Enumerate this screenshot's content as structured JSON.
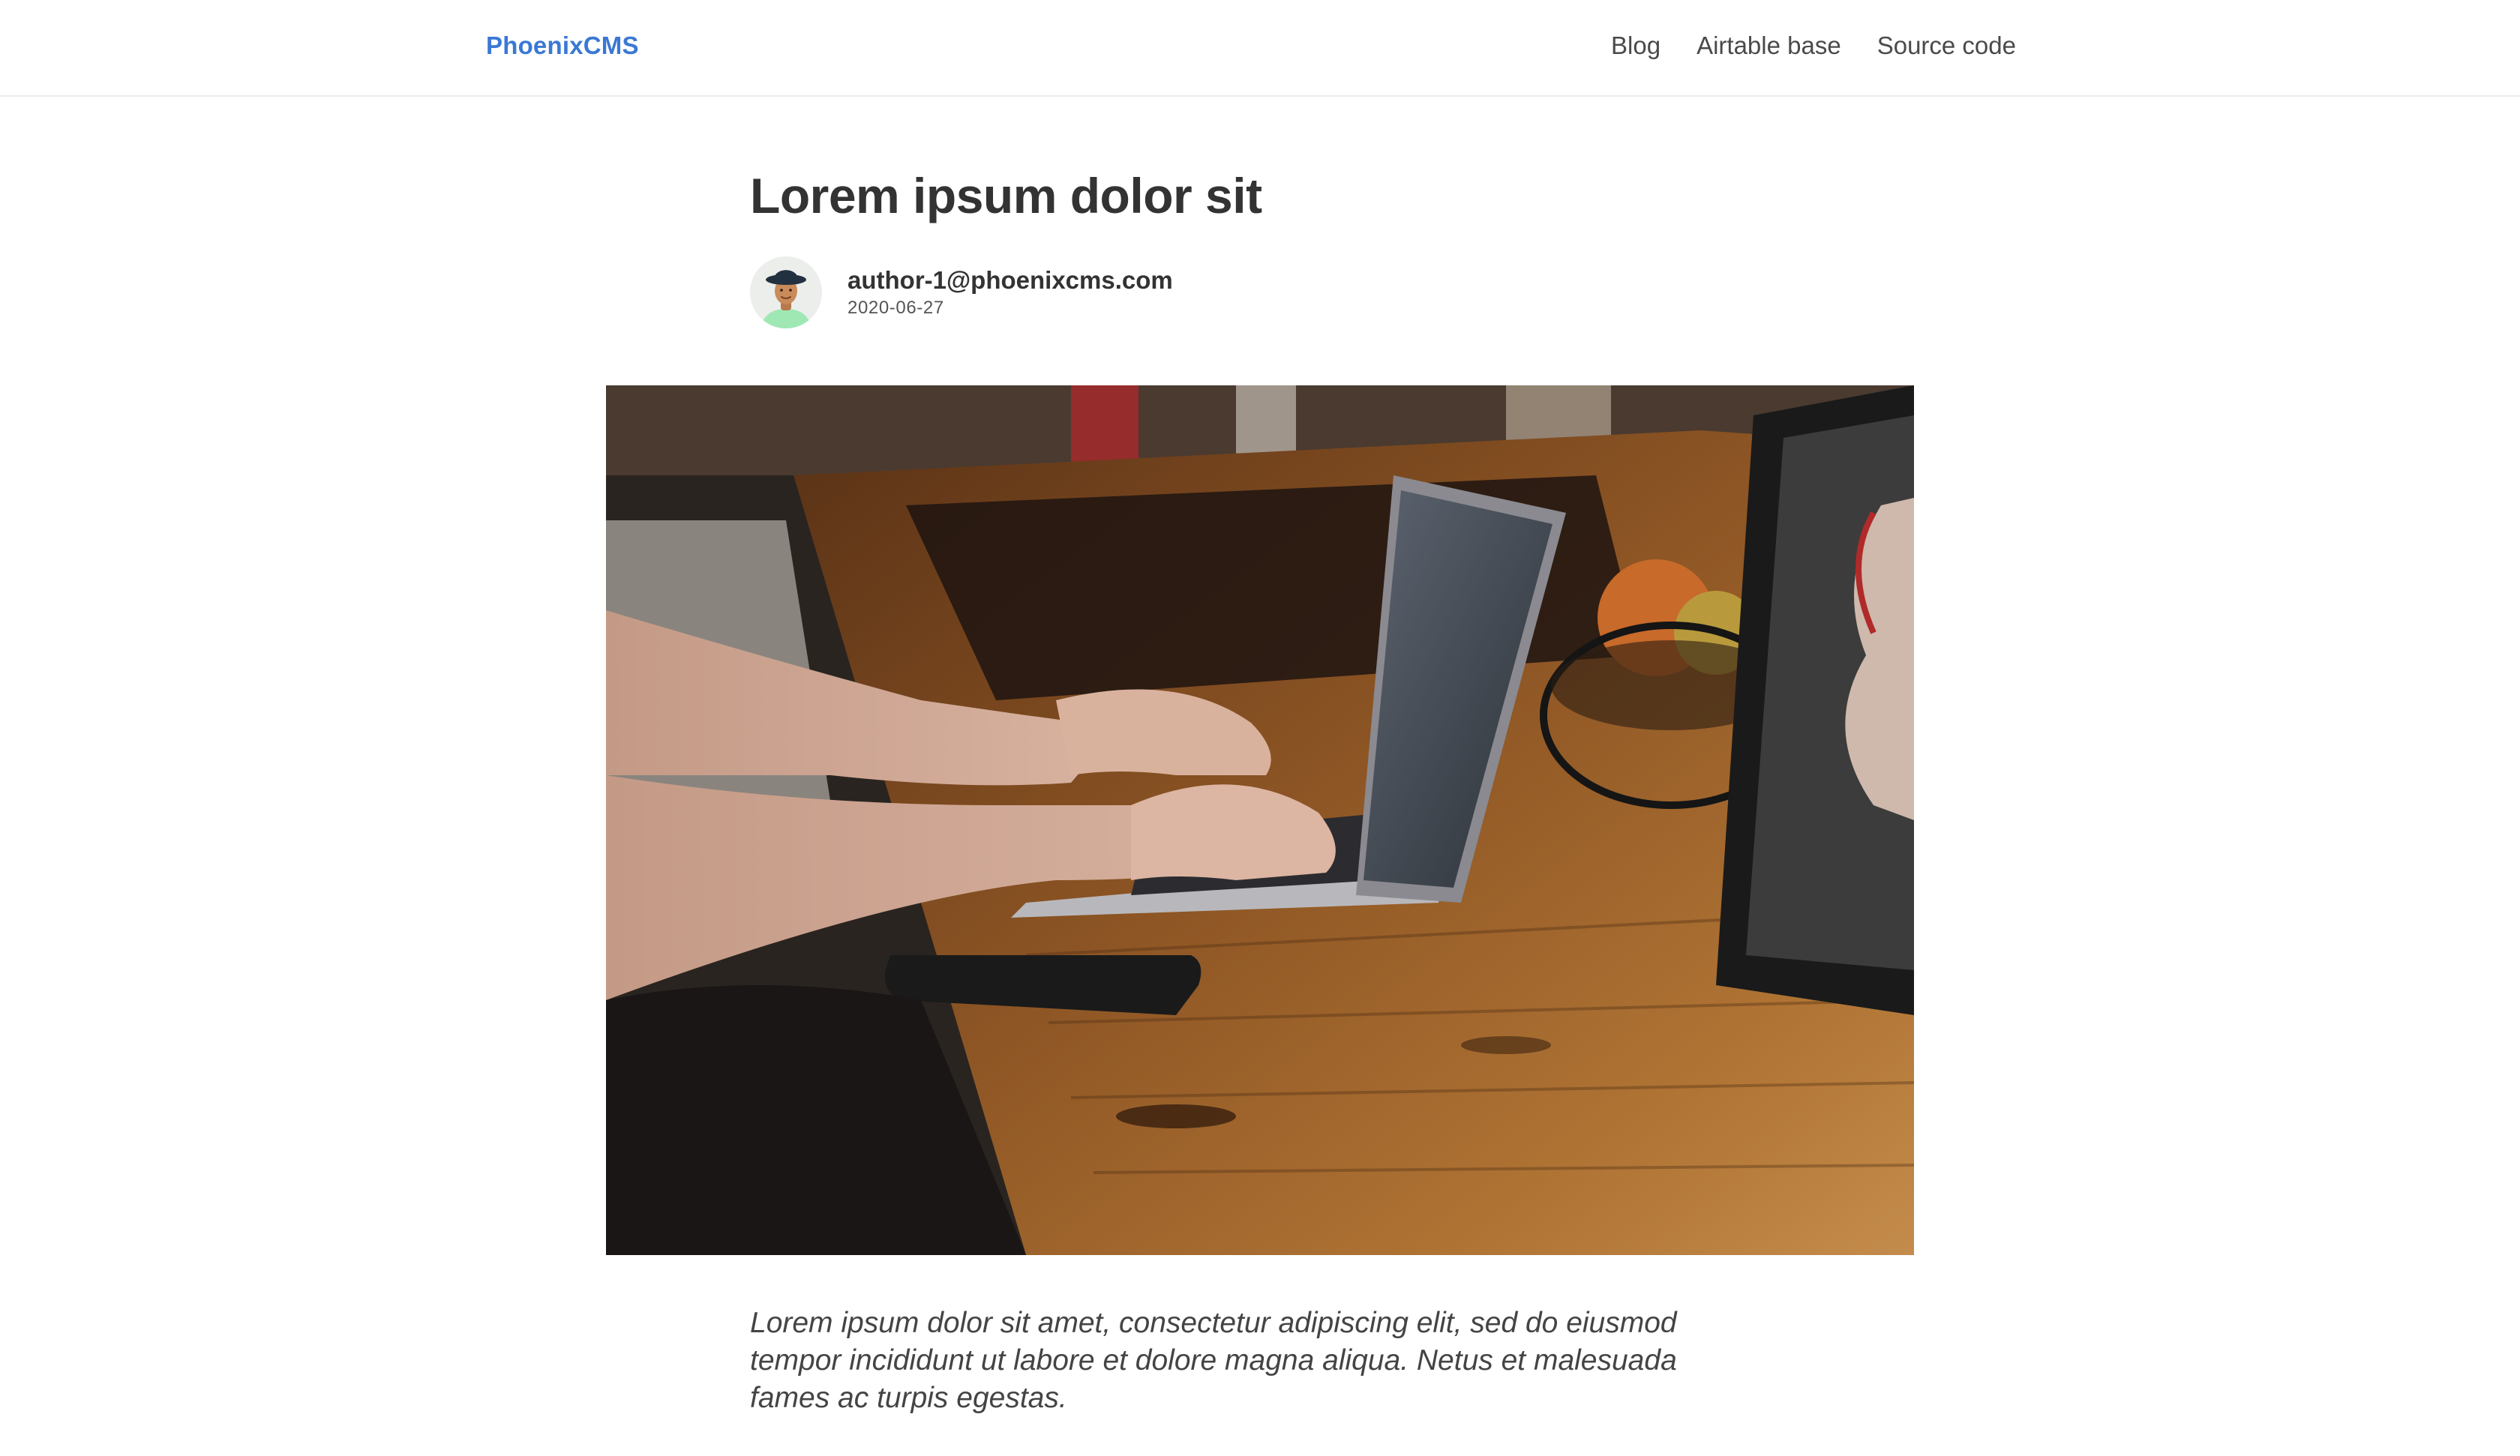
{
  "navbar": {
    "brand": "PhoenixCMS",
    "links": [
      {
        "label": "Blog"
      },
      {
        "label": "Airtable base"
      },
      {
        "label": "Source code"
      }
    ]
  },
  "article": {
    "title": "Lorem ipsum dolor sit",
    "author": "author-1@phoenixcms.com",
    "date": "2020-06-27",
    "intro": "Lorem ipsum dolor sit amet, consectetur adipiscing elit, sed do eiusmod tempor incididunt ut labore et dolore magna aliqua. Netus et malesuada fames ac turpis egestas."
  },
  "colors": {
    "brand": "#3a78d4",
    "text": "#333333",
    "muted": "#555555",
    "divider": "#ececec"
  }
}
